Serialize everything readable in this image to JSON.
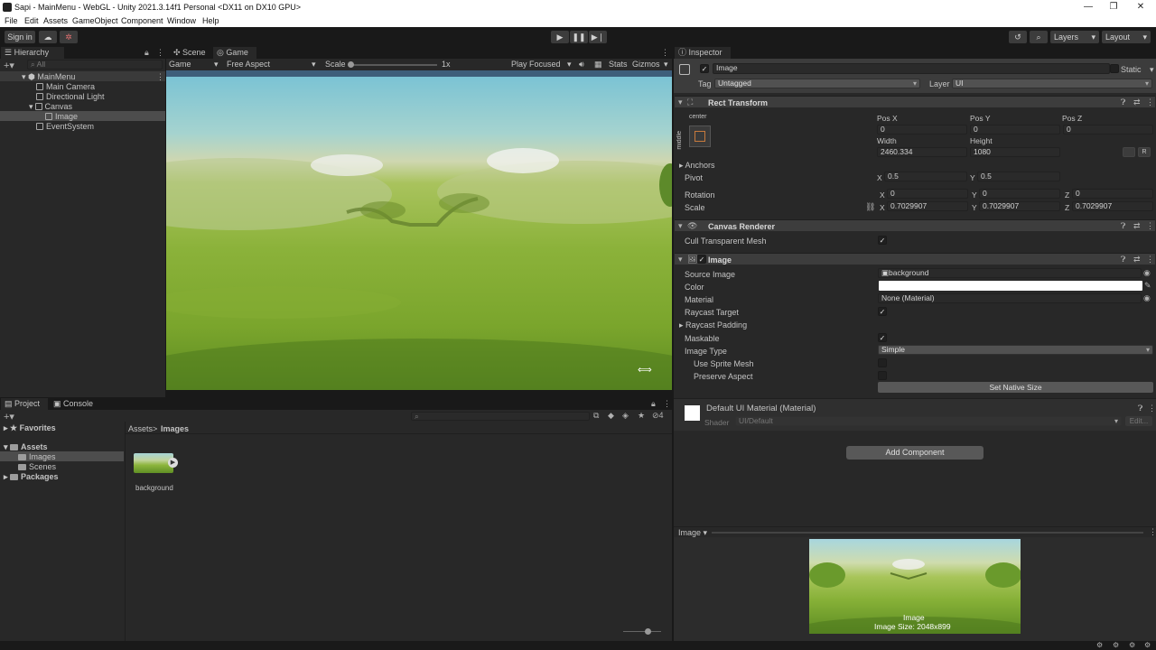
{
  "window": {
    "title": "Sapi - MainMenu - WebGL - Unity 2021.3.14f1 Personal <DX11 on DX10 GPU>",
    "minimize": "—",
    "maximize": "❐",
    "close": "✕"
  },
  "menu": [
    "File",
    "Edit",
    "Assets",
    "GameObject",
    "Component",
    "Window",
    "Help"
  ],
  "toolbar": {
    "sign_in": "Sign in",
    "layers": "Layers",
    "layout": "Layout",
    "play_icon": "play-icon",
    "pause_icon": "pause-icon",
    "step_icon": "step-icon"
  },
  "hierarchy": {
    "tab": "Hierarchy",
    "search_placeholder": "All",
    "items": [
      {
        "label": "MainMenu",
        "depth": 0
      },
      {
        "label": "Main Camera",
        "depth": 1
      },
      {
        "label": "Directional Light",
        "depth": 1
      },
      {
        "label": "Canvas",
        "depth": 1
      },
      {
        "label": "Image",
        "depth": 2
      },
      {
        "label": "EventSystem",
        "depth": 1
      }
    ]
  },
  "game_view": {
    "tab_scene": "Scene",
    "tab_game": "Game",
    "display": "Game",
    "aspect": "Free Aspect",
    "scale_label": "Scale",
    "scale_value": "1x",
    "play_focused": "Play Focused",
    "stats": "Stats",
    "gizmos": "Gizmos"
  },
  "project": {
    "tab_project": "Project",
    "tab_console": "Console",
    "favorites": "Favorites",
    "assets": "Assets",
    "images": "Images",
    "scenes": "Scenes",
    "packages": "Packages",
    "breadcrumb_root": "Assets",
    "breadcrumb_sep": ">",
    "breadcrumb_leaf": "Images",
    "hidden_count": "4",
    "asset_name": "background"
  },
  "inspector": {
    "tab": "Inspector",
    "object_name": "Image",
    "static_label": "Static",
    "tag_label": "Tag",
    "tag_value": "Untagged",
    "layer_label": "Layer",
    "layer_value": "UI",
    "rect_transform": {
      "title": "Rect Transform",
      "anchor_h": "center",
      "anchor_v": "middle",
      "posx_label": "Pos X",
      "posy_label": "Pos Y",
      "posz_label": "Pos Z",
      "posx": "0",
      "posy": "0",
      "posz": "0",
      "width_label": "Width",
      "height_label": "Height",
      "width": "2460.334",
      "height": "1080",
      "r_button": "R",
      "anchors": "Anchors",
      "pivot": "Pivot",
      "pivot_x": "0.5",
      "pivot_y": "0.5",
      "rotation": "Rotation",
      "rot_x": "0",
      "rot_y": "0",
      "rot_z": "0",
      "scale": "Scale",
      "scale_x": "0.7029907",
      "scale_y": "0.7029907",
      "scale_z": "0.7029907",
      "axis_x": "X",
      "axis_y": "Y",
      "axis_z": "Z"
    },
    "canvas_renderer": {
      "title": "Canvas Renderer",
      "cull": "Cull Transparent Mesh"
    },
    "image": {
      "title": "Image",
      "source_image_label": "Source Image",
      "source_image": "background",
      "color_label": "Color",
      "material_label": "Material",
      "material": "None (Material)",
      "raycast_target": "Raycast Target",
      "raycast_padding": "Raycast Padding",
      "maskable": "Maskable",
      "image_type_label": "Image Type",
      "image_type": "Simple",
      "use_sprite_mesh": "Use Sprite Mesh",
      "preserve_aspect": "Preserve Aspect",
      "set_native_size": "Set Native Size"
    },
    "material_block": {
      "title": "Default UI Material (Material)",
      "shader_label": "Shader",
      "shader": "UI/Default",
      "edit": "Edit..."
    },
    "add_component": "Add Component",
    "preview": {
      "label": "Image",
      "caption_name": "Image",
      "caption_size": "Image Size: 2048x899"
    }
  },
  "colors": {
    "accent_blue": "#2c5d87",
    "panel": "#282828",
    "header": "#3d3d3d"
  }
}
